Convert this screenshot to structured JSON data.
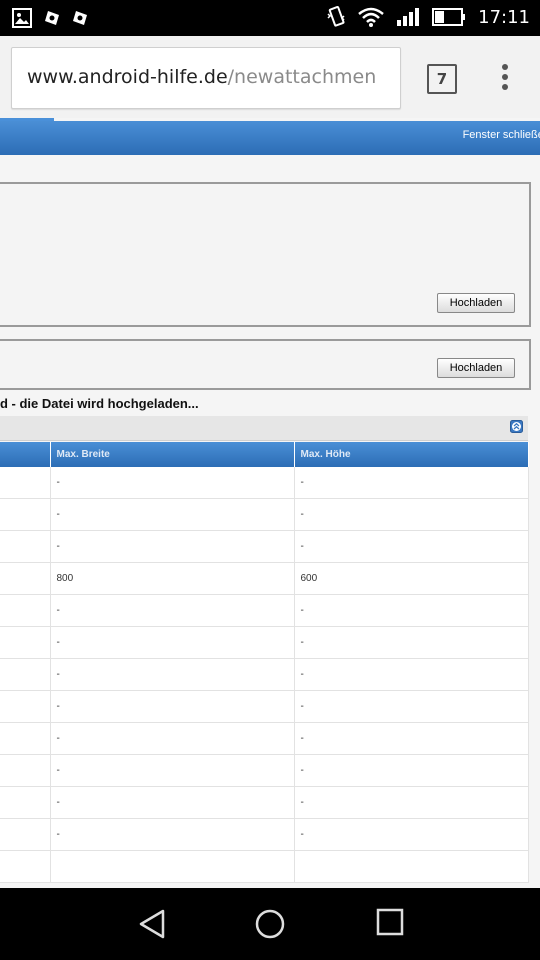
{
  "status_bar": {
    "time": "17:11",
    "left_icons": [
      "gallery-icon",
      "app-notification-icon",
      "app-notification-icon"
    ],
    "right_icons": [
      "vibrate-icon",
      "wifi-icon",
      "signal-icon",
      "battery-icon"
    ]
  },
  "browser": {
    "url_domain": "www.android-hilfe.de",
    "url_path": "/newattachmen",
    "tab_count": "7"
  },
  "page": {
    "close_link": "Fenster schließen",
    "upload_button_1": "Hochladen",
    "upload_button_2": "Hochladen",
    "status_message": "d - die Datei wird hochgeladen...",
    "table": {
      "headers": [
        "",
        "Max. Breite",
        "Max. Höhe"
      ],
      "rows": [
        [
          "",
          "-",
          "-"
        ],
        [
          "",
          "-",
          "-"
        ],
        [
          "",
          "-",
          "-"
        ],
        [
          "",
          "800",
          "600"
        ],
        [
          "",
          "-",
          "-"
        ],
        [
          "",
          "-",
          "-"
        ],
        [
          "",
          "-",
          "-"
        ],
        [
          "",
          "-",
          "-"
        ],
        [
          "",
          "-",
          "-"
        ],
        [
          "",
          "-",
          "-"
        ],
        [
          "",
          "-",
          "-"
        ],
        [
          "",
          "-",
          "-"
        ],
        [
          "",
          "",
          ""
        ]
      ]
    }
  },
  "nav_bar": {
    "icons": [
      "back-icon",
      "home-icon",
      "recent-apps-icon"
    ]
  }
}
